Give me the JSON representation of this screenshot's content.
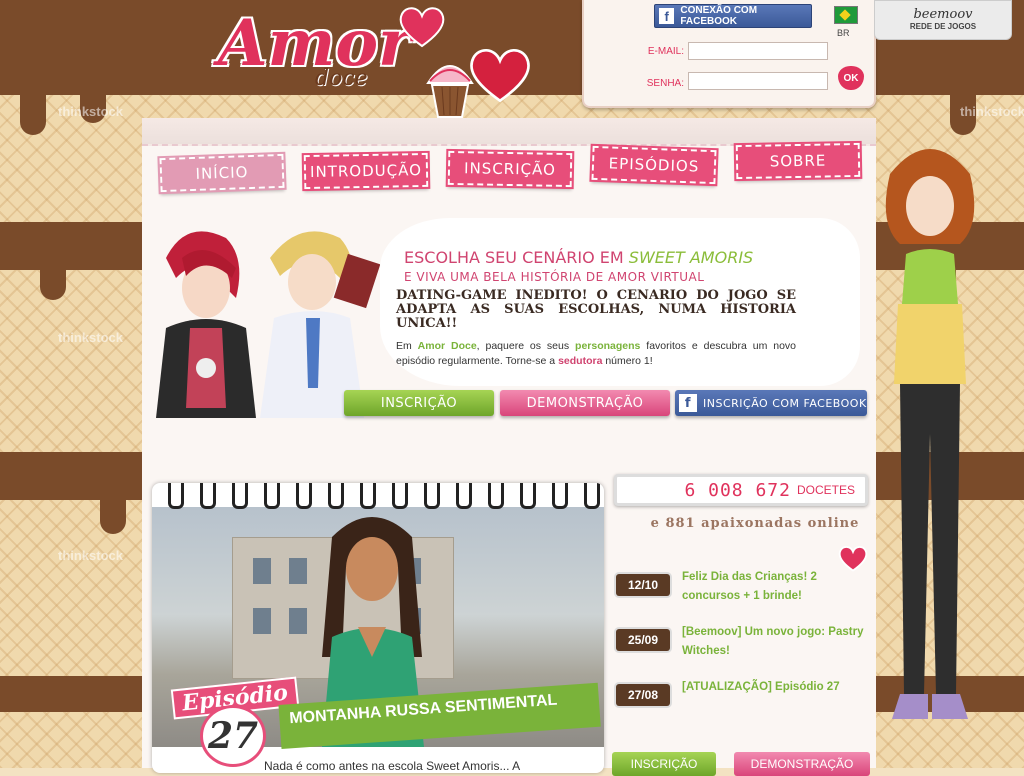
{
  "site": {
    "logo_main": "Amor",
    "logo_sub": "doce"
  },
  "login": {
    "facebook_connect": "CONEXÃO COM FACEBOOK",
    "email_label": "E-MAIL:",
    "password_label": "SENHA:",
    "ok_label": "OK",
    "language": "BR"
  },
  "network": {
    "brand": "beemoov",
    "label": "REDE DE JOGOS"
  },
  "watermark": "thinkstock",
  "nav": {
    "tabs": [
      {
        "label": "INÍCIO",
        "active": true
      },
      {
        "label": "INTRODUÇÃO",
        "active": false
      },
      {
        "label": "INSCRIÇÃO",
        "active": false
      },
      {
        "label": "EPISÓDIOS",
        "active": false
      },
      {
        "label": "SOBRE",
        "active": false
      }
    ]
  },
  "hero": {
    "title_prefix": "ESCOLHA SEU CENÁRIO EM",
    "title_highlight": "SWEET AMORIS",
    "subtitle": "E VIVA UMA BELA HISTÓRIA DE AMOR VIRTUAL",
    "headline": "DATING-GAME INEDITO! O CENARIO DO JOGO SE ADAPTA AS SUAS ESCOLHAS, NUMA HISTORIA UNICA!!",
    "text_1": "Em",
    "text_brand": "Amor Doce",
    "text_2": ", paquere os seus",
    "text_personagens": "personagens",
    "text_3": "favoritos e descubra um novo episódio regularmente. Torne-se a",
    "text_sedutora": "sedutora",
    "text_4": "número 1!"
  },
  "cta": {
    "signup": "INSCRIÇÃO",
    "demo": "DEMONSTRAÇÃO",
    "facebook_signup": "INSCRIÇÃO COM FACEBOOK"
  },
  "episode": {
    "label": "Episódio",
    "number": "27",
    "title": "MONTANHA RUSSA SENTIMENTAL",
    "teaser": "Nada é como antes na escola Sweet Amoris... A"
  },
  "stats": {
    "players": "6 008 672",
    "players_unit": "DOCETES",
    "online": "e 881 apaixonadas online"
  },
  "news": [
    {
      "date": "12/10",
      "text": "Feliz Dia das Crianças! 2 concursos + 1 brinde!"
    },
    {
      "date": "25/09",
      "text": "[Beemoov] Um novo jogo: Pastry Witches!"
    },
    {
      "date": "27/08",
      "text": "[ATUALIZAÇÃO] Episódio 27"
    }
  ],
  "bottom_cta": {
    "signup": "INSCRIÇÃO",
    "demo": "DEMONSTRAÇÃO"
  },
  "colors": {
    "brand_pink": "#e0325c",
    "green": "#7ab33a",
    "chocolate": "#7a4b2a",
    "facebook": "#3b5998"
  }
}
